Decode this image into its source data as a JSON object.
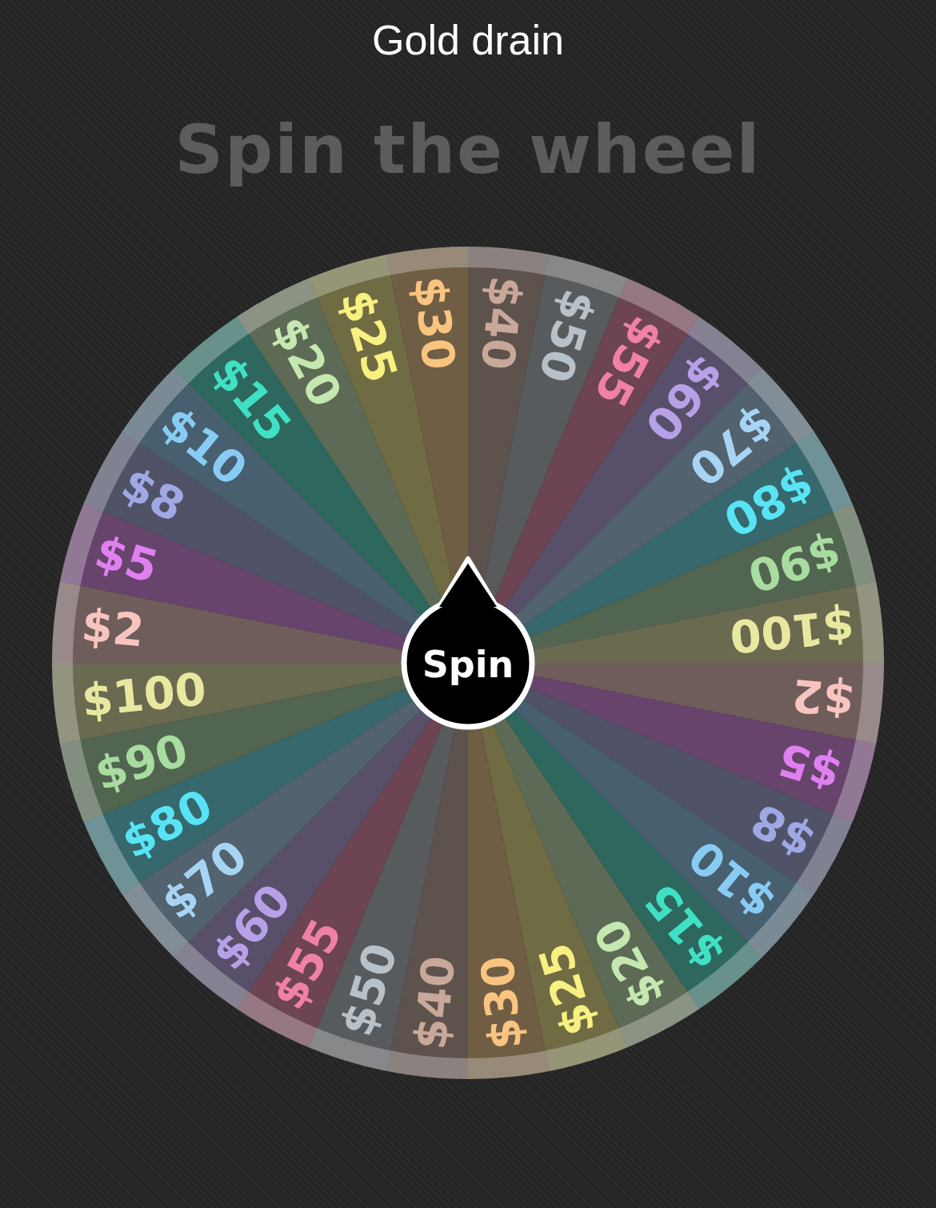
{
  "window": {
    "title": "Gold drain"
  },
  "heading": "Spin the wheel",
  "wheel": {
    "segments": [
      {
        "label": "$40",
        "color": "#c8a898"
      },
      {
        "label": "$50",
        "color": "#b8c0c8"
      },
      {
        "label": "$55",
        "color": "#f080a8"
      },
      {
        "label": "$60",
        "color": "#b8a0e8"
      },
      {
        "label": "$70",
        "color": "#a8d4f4"
      },
      {
        "label": "$80",
        "color": "#58e4f4"
      },
      {
        "label": "$90",
        "color": "#a8dca0"
      },
      {
        "label": "$100",
        "color": "#e8e8a0"
      },
      {
        "label": "$2",
        "color": "#f8c4c0"
      },
      {
        "label": "$5",
        "color": "#e080f0"
      },
      {
        "label": "$8",
        "color": "#a0a8e4"
      },
      {
        "label": "$10",
        "color": "#88ccf4"
      },
      {
        "label": "$15",
        "color": "#40e0c4"
      },
      {
        "label": "$20",
        "color": "#c4e8b0"
      },
      {
        "label": "$25",
        "color": "#f8f080"
      },
      {
        "label": "$30",
        "color": "#f8c480"
      },
      {
        "label": "$40",
        "color": "#c8a898"
      },
      {
        "label": "$50",
        "color": "#b8c0c8"
      },
      {
        "label": "$55",
        "color": "#f080a8"
      },
      {
        "label": "$60",
        "color": "#b8a0e8"
      },
      {
        "label": "$70",
        "color": "#a8d4f4"
      },
      {
        "label": "$80",
        "color": "#58e4f4"
      },
      {
        "label": "$90",
        "color": "#a8dca0"
      },
      {
        "label": "$100",
        "color": "#e8e8a0"
      },
      {
        "label": "$2",
        "color": "#f8c4c0"
      },
      {
        "label": "$5",
        "color": "#e080f0"
      },
      {
        "label": "$8",
        "color": "#a0a8e4"
      },
      {
        "label": "$10",
        "color": "#88ccf4"
      },
      {
        "label": "$15",
        "color": "#40e0c4"
      },
      {
        "label": "$20",
        "color": "#c4e8b0"
      },
      {
        "label": "$25",
        "color": "#f8f080"
      },
      {
        "label": "$30",
        "color": "#f8c480"
      }
    ],
    "spin_button": "Spin"
  }
}
